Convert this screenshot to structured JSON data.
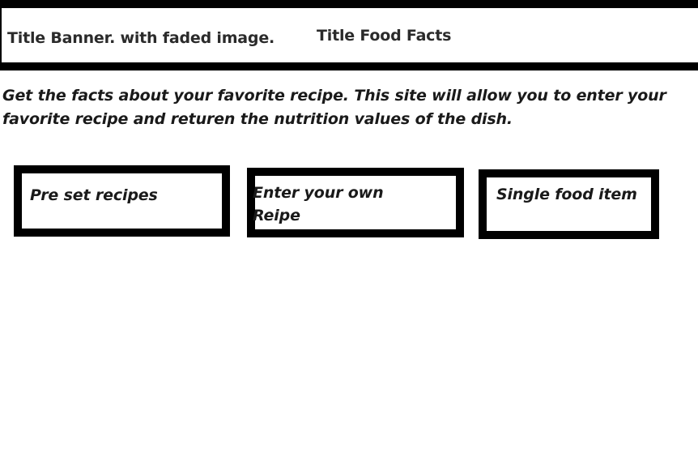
{
  "header": {
    "banner_note": "Title Banner. with faded image.",
    "title": "Title Food Facts"
  },
  "intro": {
    "text": "Get the facts about your favorite recipe.  This site will allow you to enter your favorite recipe and returen the nutrition values of the dish."
  },
  "options": {
    "preset_label": "Pre set recipes",
    "own_label": "Enter your own Reipe",
    "single_label": "Single food item"
  },
  "colors": {
    "border": "#000000",
    "background": "#ffffff",
    "text": "#1a1a1a"
  }
}
